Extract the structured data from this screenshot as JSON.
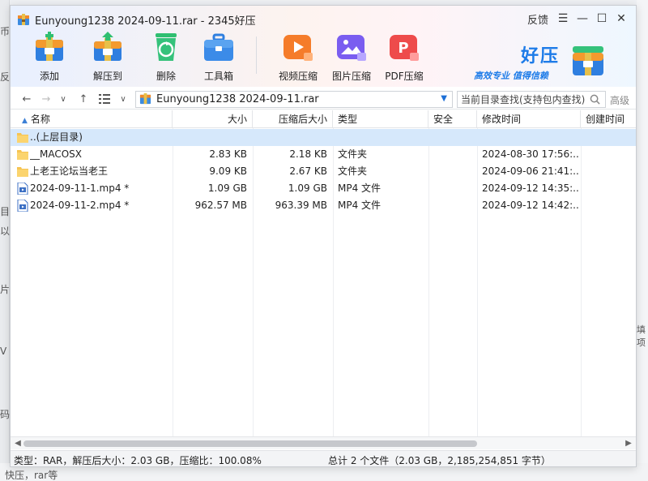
{
  "background": {
    "left_fragments": [
      "币",
      "反",
      "目",
      "以",
      "片",
      "V",
      "码"
    ],
    "right_fragment": "填项",
    "bottom_text": "快压，rar等"
  },
  "window": {
    "title": "Eunyoung1238 2024-09-11.rar - 2345好压",
    "controls": {
      "feedback": "反馈",
      "menu": "☰",
      "minimize": "—",
      "maximize": "☐",
      "close": "✕"
    }
  },
  "toolbar": {
    "items": [
      {
        "label": "添加",
        "icon": "add-archive-icon"
      },
      {
        "label": "解压到",
        "icon": "extract-icon"
      },
      {
        "label": "删除",
        "icon": "recycle-icon"
      },
      {
        "label": "工具箱",
        "icon": "toolbox-icon"
      },
      {
        "label": "视频压缩",
        "icon": "video-compress-icon"
      },
      {
        "label": "图片压缩",
        "icon": "image-compress-icon"
      },
      {
        "label": "PDF压缩",
        "icon": "pdf-compress-icon"
      }
    ],
    "brand": {
      "name": "好压",
      "slogan": "高效专业  值得信赖"
    }
  },
  "addressbar": {
    "path": "Eunyoung1238 2024-09-11.rar",
    "search_placeholder": "当前目录查找(支持包内查找)",
    "advanced": "高级"
  },
  "table": {
    "columns": [
      "名称",
      "大小",
      "压缩后大小",
      "类型",
      "安全",
      "修改时间",
      "创建时间"
    ],
    "rows": [
      {
        "name": "..(上层目录)",
        "size": "",
        "packed": "",
        "type": "",
        "security": "",
        "modified": "",
        "created": "",
        "icon": "folder",
        "selected": true
      },
      {
        "name": "__MACOSX",
        "size": "2.83 KB",
        "packed": "2.18 KB",
        "type": "文件夹",
        "security": "",
        "modified": "2024-08-30 17:56:...",
        "created": "",
        "icon": "folder",
        "selected": false
      },
      {
        "name": "上老王论坛当老王",
        "size": "9.09 KB",
        "packed": "2.67 KB",
        "type": "文件夹",
        "security": "",
        "modified": "2024-09-06 21:41:...",
        "created": "",
        "icon": "folder",
        "selected": false
      },
      {
        "name": "2024-09-11-1.mp4 *",
        "size": "1.09 GB",
        "packed": "1.09 GB",
        "type": "MP4 文件",
        "security": "",
        "modified": "2024-09-12 14:35:...",
        "created": "",
        "icon": "video-file",
        "selected": false
      },
      {
        "name": "2024-09-11-2.mp4 *",
        "size": "962.57 MB",
        "packed": "963.39 MB",
        "type": "MP4 文件",
        "security": "",
        "modified": "2024-09-12 14:42:...",
        "created": "",
        "icon": "video-file",
        "selected": false
      }
    ]
  },
  "statusbar": {
    "left": "类型：RAR，解压后大小：2.03 GB，压缩比：100.08%",
    "right": "总计 2 个文件（2.03 GB，2,185,254,851 字节）"
  }
}
